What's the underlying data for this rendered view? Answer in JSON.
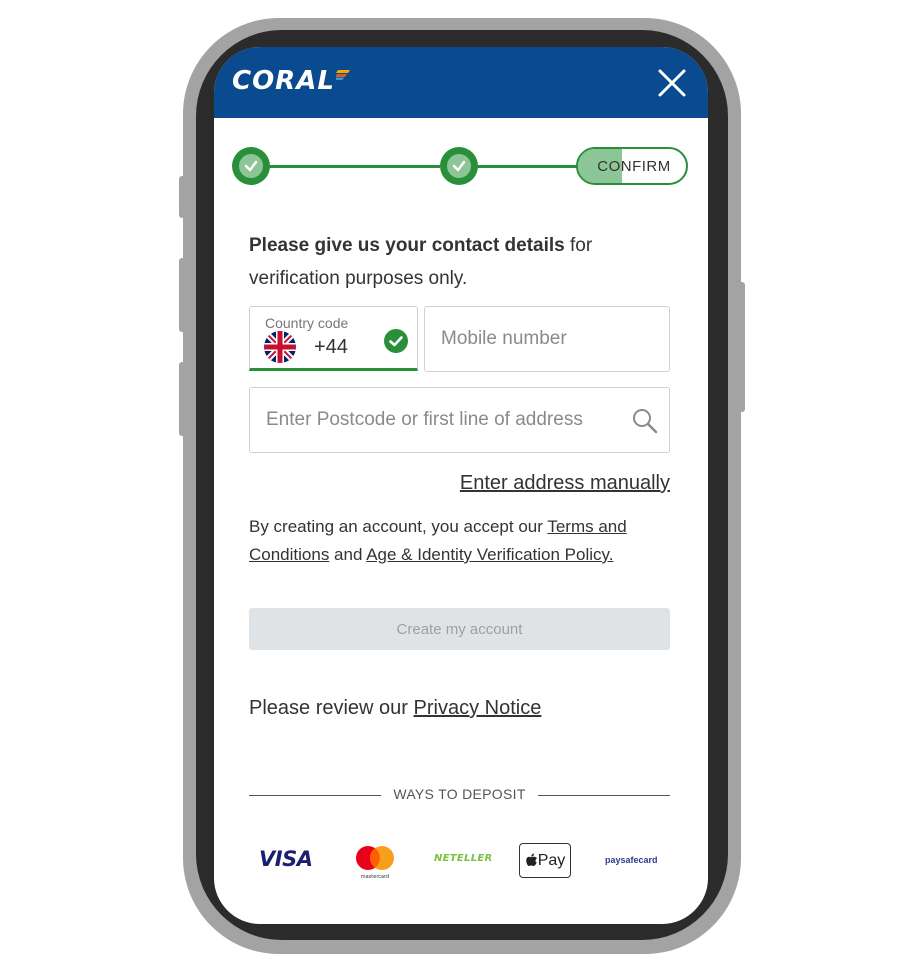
{
  "header": {
    "logo_text": "CORAL",
    "close_icon": "close-icon",
    "background_color": "#0a4a8e"
  },
  "stepper": {
    "steps": [
      {
        "state": "complete",
        "icon": "check-icon"
      },
      {
        "state": "complete",
        "icon": "check-icon"
      },
      {
        "state": "current",
        "label": "CONFIRM"
      }
    ],
    "accent_color": "#2a8f3a"
  },
  "form": {
    "intro_bold": "Please give us your contact details",
    "intro_rest": " for verification purposes only.",
    "country_code": {
      "label": "Country code",
      "value": "+44",
      "flag_icon": "uk-flag-icon",
      "status_icon": "check-circle-icon"
    },
    "mobile": {
      "placeholder": "Mobile number",
      "value": ""
    },
    "address": {
      "placeholder": "Enter Postcode or first line of address",
      "value": "",
      "icon": "search-icon"
    },
    "manual_link": "Enter address manually",
    "terms": {
      "prefix": "By creating an account, you accept our ",
      "terms_link": "Terms and Conditions",
      "middle": " and ",
      "policy_link": "Age & Identity Verification Policy."
    },
    "create_button": "Create my account",
    "privacy_prefix": "Please review our ",
    "privacy_link": "Privacy Notice"
  },
  "deposit": {
    "heading": "WAYS TO DEPOSIT",
    "methods": {
      "visa": "VISA",
      "mastercard": "mastercard",
      "neteller": "NETELLER",
      "applepay": "Pay",
      "paysafe": "paysafecard"
    }
  }
}
